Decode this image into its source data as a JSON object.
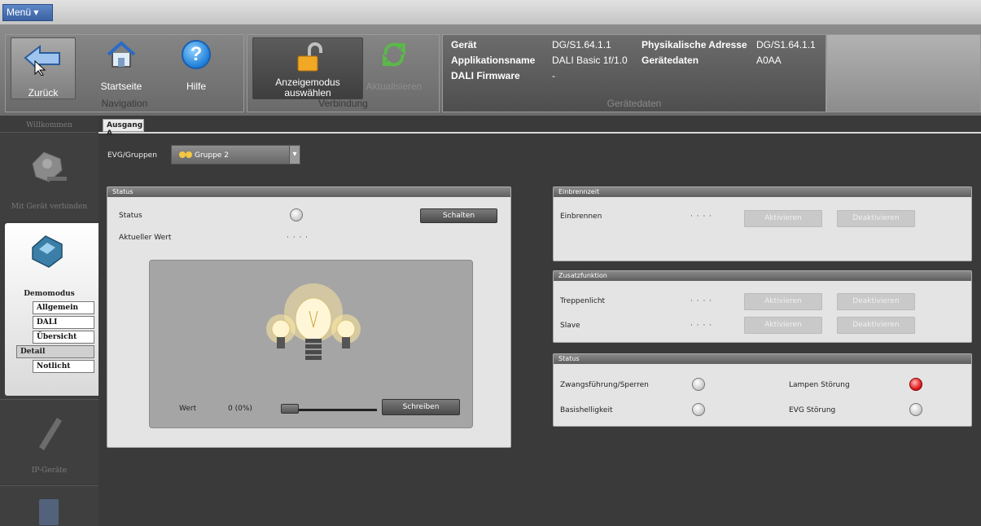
{
  "menubar": {
    "menu_label": "Menü ▾"
  },
  "ribbon": {
    "navigation": {
      "label": "Navigation",
      "back_label": "Zurück",
      "home_label": "Startseite",
      "help_label": "Hilfe",
      "help_glyph": "?"
    },
    "connection": {
      "label": "Verbindung",
      "mode_label_line1": "Anzeigemodus",
      "mode_label_line2": "auswählen",
      "refresh_label": "Aktualisieren"
    },
    "device": {
      "label": "Gerätedaten",
      "rows": [
        {
          "key": "Gerät",
          "value": "DG/S1.64.1.1"
        },
        {
          "key": "Applikationsname",
          "value": "DALI Basic 1f/1.0"
        },
        {
          "key": "DALI Firmware",
          "value": "-"
        }
      ],
      "right_rows": [
        {
          "key": "Physikalische Adresse",
          "value": "DG/S1.64.1.1"
        },
        {
          "key": "Gerätedaten",
          "value": "A0AA"
        }
      ]
    }
  },
  "sidebar": {
    "welcome": "Willkommen",
    "connect": "Mit Gerät verbinden",
    "demo": "Demomodus",
    "sub_items": [
      "Allgemein",
      "DALI",
      "Übersicht"
    ],
    "detail": "Detail",
    "notlicht": "Notlicht",
    "ip": "IP-Geräte"
  },
  "tabs": {
    "active": "Ausgang A"
  },
  "evg": {
    "label": "EVG/Gruppen",
    "selected": "Gruppe 2"
  },
  "status_panel": {
    "title": "Status",
    "status_label": "Status",
    "schalten": "Schalten",
    "current_label": "Aktueller Wert",
    "current_value": "· · · ·",
    "wert_label": "Wert",
    "wert_value": "0 (0%)",
    "slider_level": 0,
    "schreiben": "Schreiben"
  },
  "einbrenn_panel": {
    "title": "Einbrennzeit",
    "row_label": "Einbrennen",
    "row_value": "· · · ·",
    "activate": "Aktivieren",
    "deactivate": "Deaktivieren"
  },
  "zusatz_panel": {
    "title": "Zusatzfunktion",
    "rows": [
      {
        "label": "Treppenlicht",
        "value": "· · · ·",
        "activate": "Aktivieren",
        "deactivate": "Deaktivieren"
      },
      {
        "label": "Slave",
        "value": "· · · ·",
        "activate": "Aktivieren",
        "deactivate": "Deaktivieren"
      }
    ]
  },
  "status2_panel": {
    "title": "Status",
    "left": [
      {
        "label": "Zwangsführung/Sperren"
      },
      {
        "label": "Basishelligkeit"
      }
    ],
    "right": [
      {
        "label": "Lampen Störung"
      },
      {
        "label": "EVG Störung"
      }
    ]
  },
  "colors": {
    "accent_menu": "#3b62a3",
    "error_led": "#e02020"
  }
}
